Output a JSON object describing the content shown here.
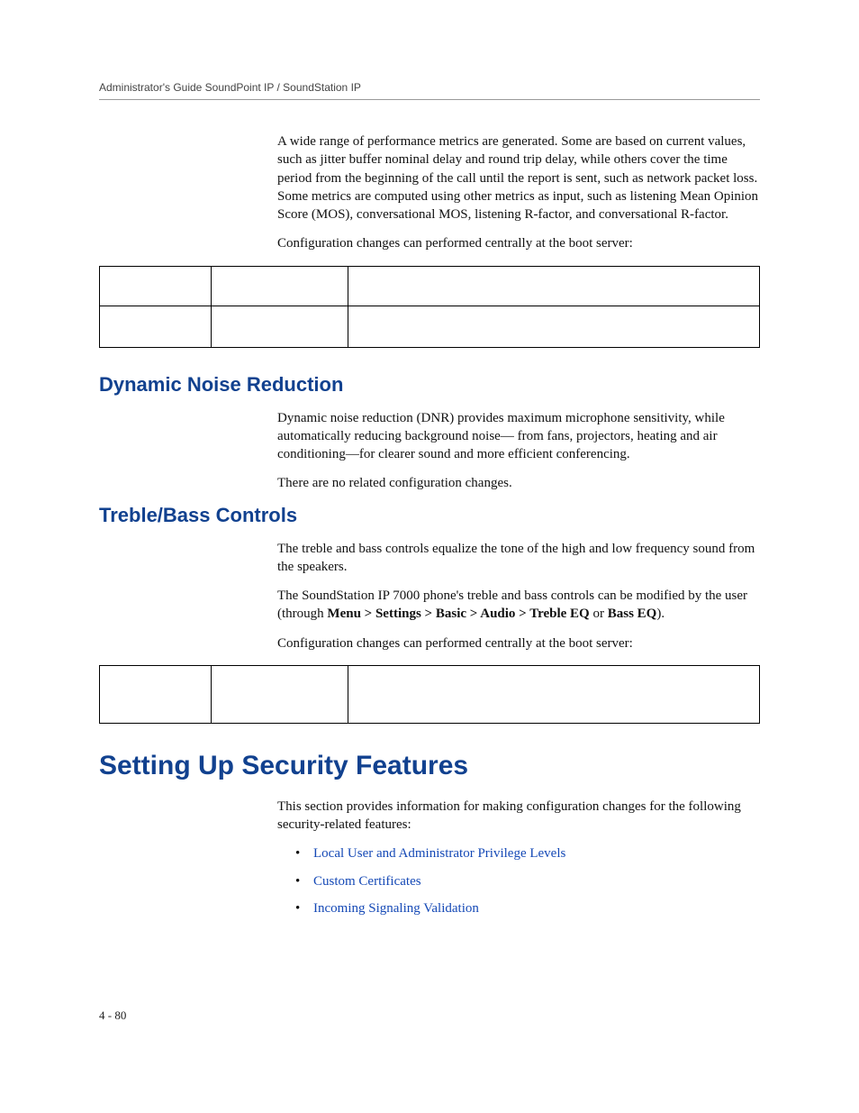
{
  "header": {
    "running": "Administrator's Guide SoundPoint IP / SoundStation IP"
  },
  "intro": {
    "p1": "A wide range of performance metrics are generated. Some are based on current values, such as jitter buffer nominal delay and round trip delay, while others cover the time period from the beginning of the call until the report is sent, such as network packet loss. Some metrics are computed using other metrics as input, such as listening Mean Opinion Score (MOS), conversational MOS, listening R-factor, and conversational R-factor.",
    "p2": "Configuration changes can performed centrally at the boot server:"
  },
  "dnr": {
    "heading": "Dynamic Noise Reduction",
    "p1": "Dynamic noise reduction (DNR) provides maximum microphone sensitivity, while automatically reducing background noise—  from fans, projectors, heating and air conditioning—for clearer sound and more efficient conferencing.",
    "p2": "There are no related configuration changes."
  },
  "tb": {
    "heading": "Treble/Bass Controls",
    "p1": "The treble and bass controls equalize the tone of the high and low frequency sound from the speakers.",
    "p2_pre": "The SoundStation IP 7000 phone's treble and bass controls can be modified by the user (through ",
    "p2_bold1": "Menu > Settings > Basic > Audio > Treble EQ",
    "p2_mid": " or ",
    "p2_bold2": "Bass EQ",
    "p2_post": ").",
    "p3": "Configuration changes can performed centrally at the boot server:"
  },
  "sec": {
    "heading": "Setting Up Security Features",
    "p1": "This section provides information for making configuration changes for the following security-related features:",
    "links": [
      "Local User and Administrator Privilege Levels",
      "Custom Certificates",
      "Incoming Signaling Validation"
    ]
  },
  "pagenum": "4 - 80"
}
